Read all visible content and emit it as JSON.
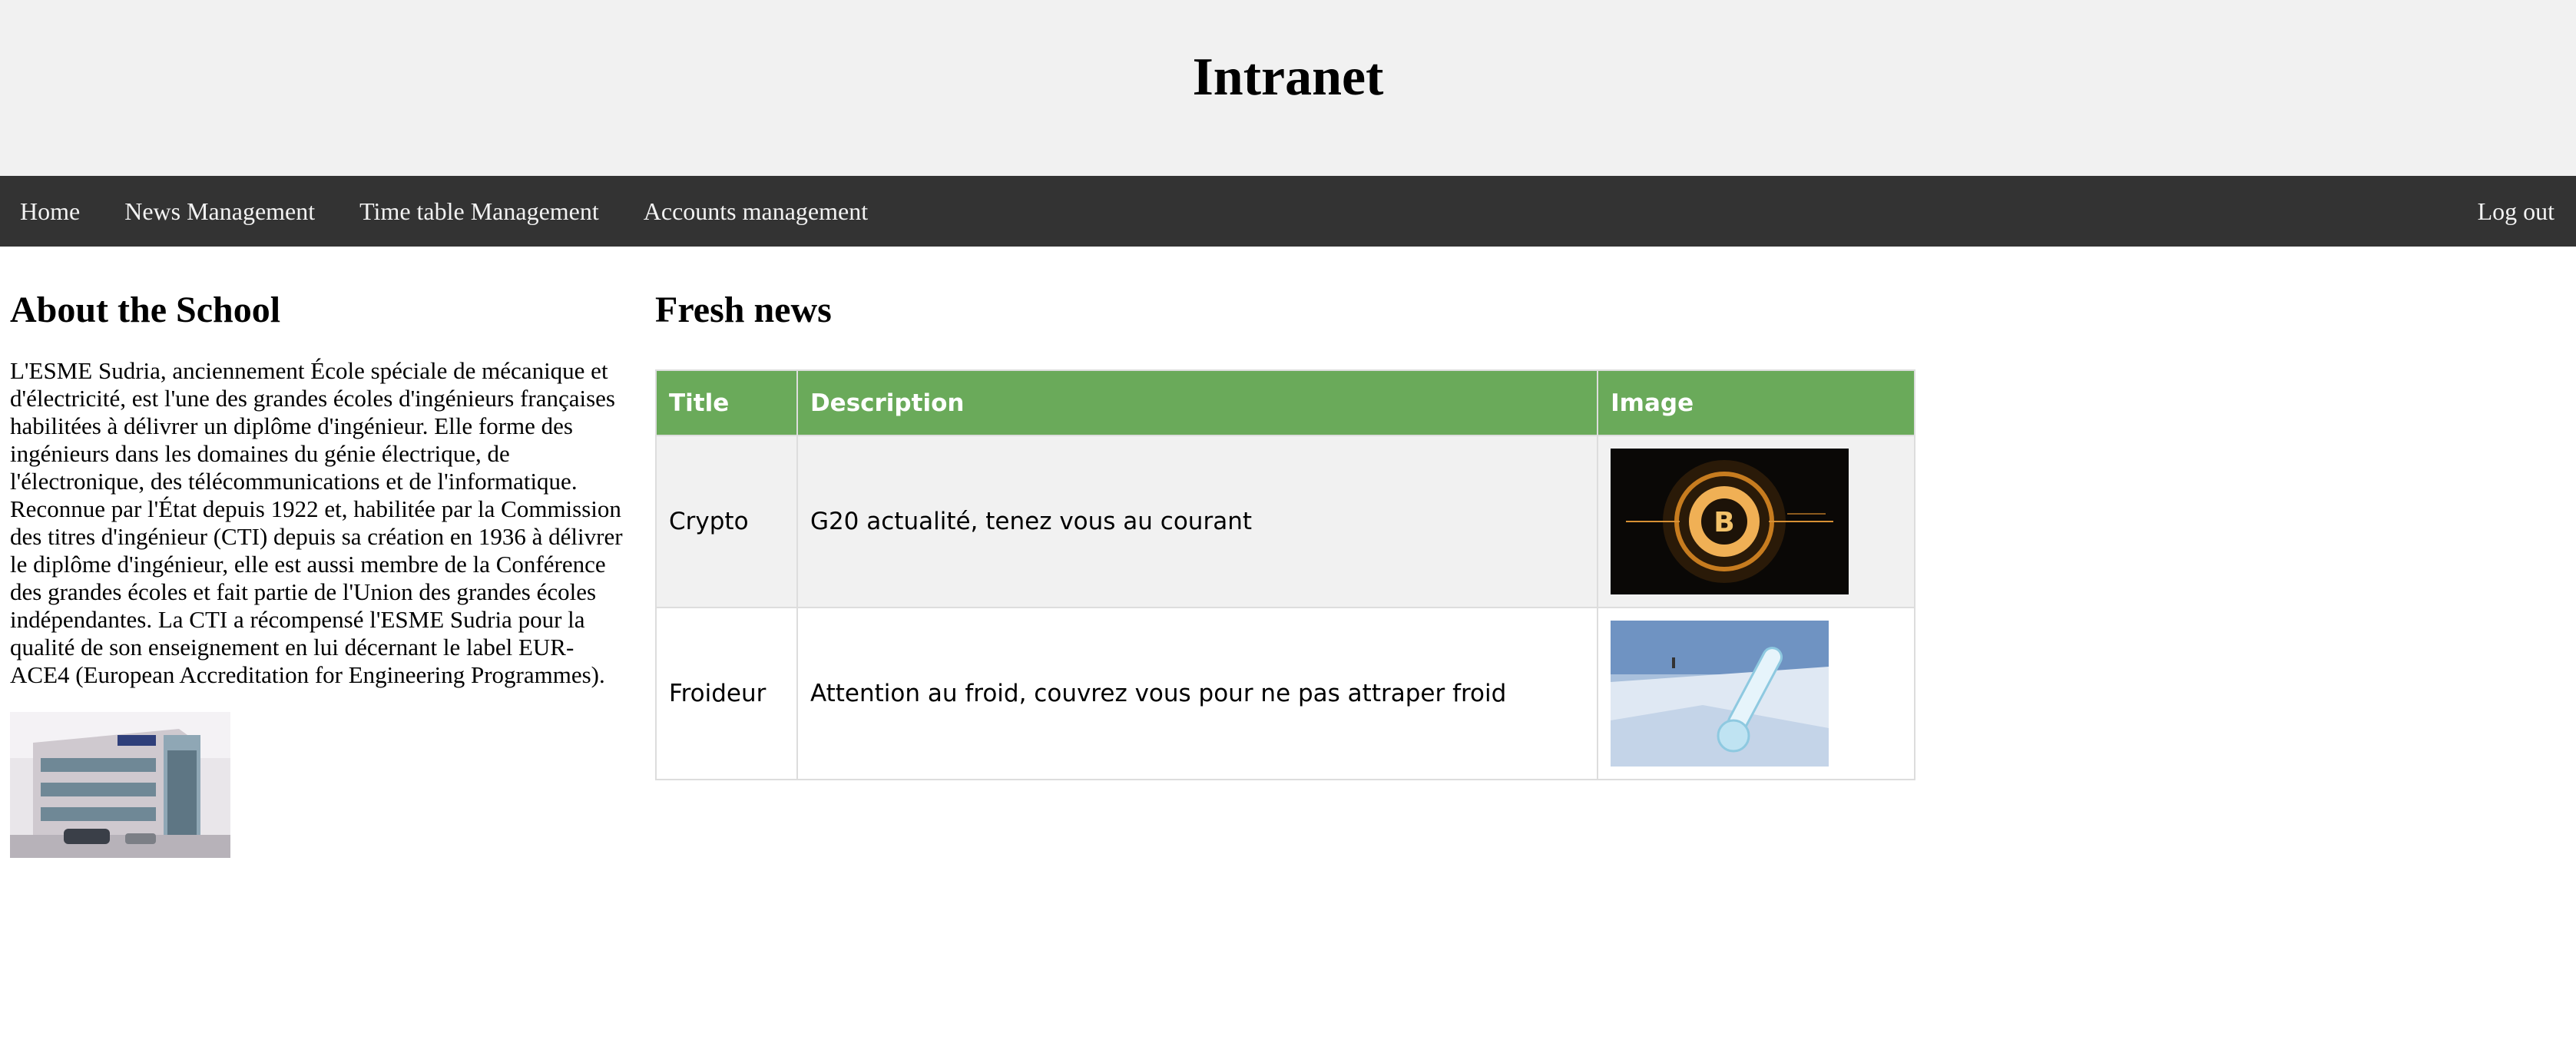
{
  "header": {
    "title": "Intranet"
  },
  "nav": {
    "items": [
      {
        "label": "Home"
      },
      {
        "label": "News Management"
      },
      {
        "label": "Time table Management"
      },
      {
        "label": "Accounts management"
      }
    ],
    "logout_label": "Log out"
  },
  "about": {
    "heading": "About the School",
    "text": "L'ESME Sudria, anciennement École spéciale de mécanique et d'électricité, est l'une des grandes écoles d'ingénieurs françaises habilitées à délivrer un diplôme d'ingénieur. Elle forme des ingénieurs dans les domaines du génie électrique, de l'électronique, des télécommunications et de l'informatique. Reconnue par l'État depuis 1922 et, habilitée par la Commission des titres d'ingénieur (CTI) depuis sa création en 1936 à délivrer le diplôme d'ingénieur, elle est aussi membre de la Conférence des grandes écoles et fait partie de l'Union des grandes écoles indépendantes. La CTI a récompensé l'ESME Sudria pour la qualité de son enseignement en lui décernant le label EUR-ACE4 (European Accreditation for Engineering Programmes)."
  },
  "news": {
    "heading": "Fresh news",
    "columns": [
      "Title",
      "Description",
      "Image"
    ],
    "rows": [
      {
        "title": "Crypto",
        "description": "G20 actualité, tenez vous au courant"
      },
      {
        "title": "Froideur",
        "description": "Attention au froid, couvrez vous pour ne pas attraper froid"
      }
    ]
  }
}
